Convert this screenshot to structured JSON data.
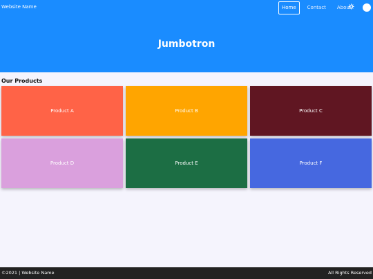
{
  "navbar": {
    "brand": "Website Name",
    "links": [
      {
        "label": "Home",
        "active": true
      },
      {
        "label": "Contact",
        "active": false
      },
      {
        "label": "About",
        "active": false
      }
    ],
    "settings_icon": "gear-icon",
    "avatar_icon": "avatar-circle"
  },
  "jumbotron": {
    "title": "Jumbotron"
  },
  "products": {
    "heading": "Our Products",
    "items": [
      {
        "label": "Product A",
        "color": "#ff6347"
      },
      {
        "label": "Product B",
        "color": "#ffa500"
      },
      {
        "label": "Product C",
        "color": "#601622"
      },
      {
        "label": "Product D",
        "color": "#daa0dd"
      },
      {
        "label": "Product E",
        "color": "#1c6e44"
      },
      {
        "label": "Product F",
        "color": "#4668e0"
      }
    ]
  },
  "footer": {
    "left": "©2021 | Website Name",
    "right": "All Rights Reserved"
  },
  "colors": {
    "primary": "#1a8cff",
    "background": "#f5f4fd",
    "footer": "#222222"
  }
}
